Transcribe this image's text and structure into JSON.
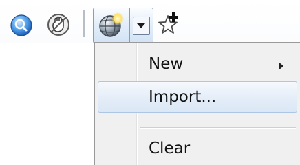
{
  "toolbar": {
    "icons": {
      "search": "search-icon",
      "pan": "pan-hand-icon",
      "globe": "globe-icon",
      "star": "add-favorite-star-icon"
    }
  },
  "menu": {
    "items": [
      {
        "label": "New",
        "has_submenu": true
      },
      {
        "label": "Import...",
        "highlighted": true
      },
      {
        "label": "Clear"
      }
    ]
  },
  "colors": {
    "highlight": "#dbe7f6",
    "highlight_border": "#aec6e6",
    "menu_background": "#f0f0f0"
  }
}
